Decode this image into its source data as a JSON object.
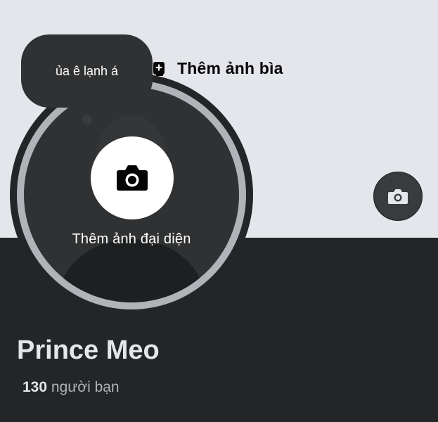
{
  "cover": {
    "background_color": "#e4e6eb",
    "add_cover_label": "Thêm ảnh bìa",
    "add_cover_icon": "add-photo-icon",
    "camera_icon": "camera-icon"
  },
  "avatar": {
    "add_label": "Thêm ảnh đại diện",
    "camera_icon": "camera-icon",
    "ring_color": "#b0b3b8"
  },
  "note_bubble": {
    "text": "ủa ê lạnh á"
  },
  "profile": {
    "name": "Prince Meo",
    "friend_count": "130",
    "friend_label": "người bạn"
  },
  "colors": {
    "page_background": "#242526",
    "primary_text": "#e4e6eb",
    "secondary_text": "#b0b3b8"
  }
}
